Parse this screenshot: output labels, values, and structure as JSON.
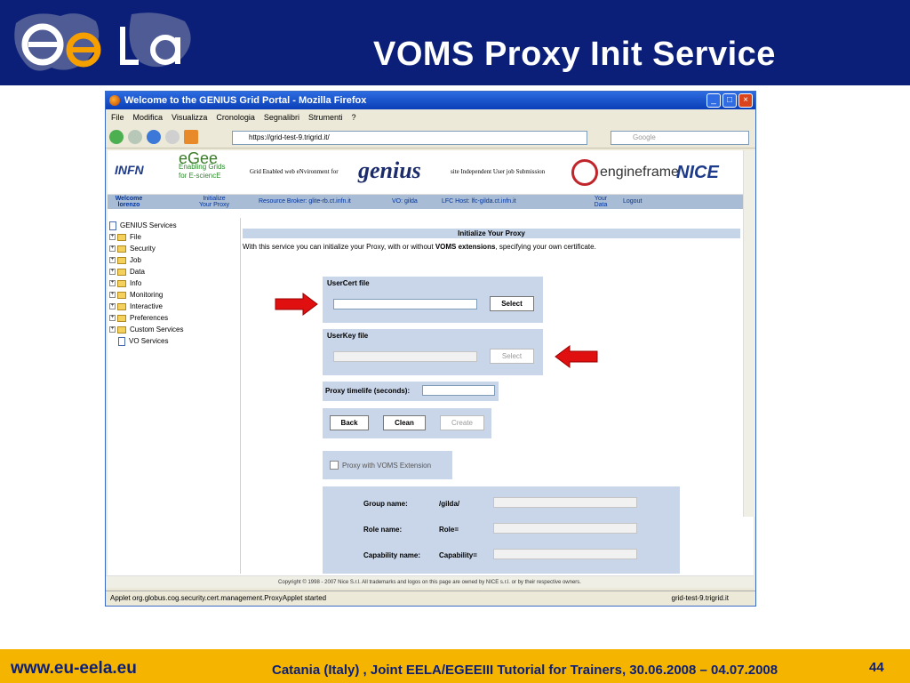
{
  "slide": {
    "title": "VOMS Proxy Init Service",
    "site": "www.eu-eela.eu",
    "footer": "Catania (Italy) , Joint EELA/EGEEIII Tutorial for Trainers, 30.06.2008 – 04.07.2008",
    "page_number": "44"
  },
  "browser": {
    "title": "Welcome to the GENIUS Grid Portal - Mozilla Firefox",
    "menu": [
      "File",
      "Modifica",
      "Visualizza",
      "Cronologia",
      "Segnalibri",
      "Strumenti",
      "?"
    ],
    "url": "https://grid-test-9.trigrid.it/",
    "search_placeholder": "Google",
    "status": "Applet org.globus.cog.security.cert.management.ProxyApplet started",
    "status_host": "grid-test-9.trigrid.it"
  },
  "portal": {
    "banner": {
      "infn": "INFN",
      "egee_logo": "eGee",
      "egee_tag1": "Enabling Grids",
      "egee_tag2": "for E-sciencE",
      "genius_left": "Grid Enabled web eNvironment for",
      "genius_logo": "genius",
      "genius_right": "site Independent User job Submission",
      "engine": "engineframe",
      "nice": "NICE"
    },
    "tabs": {
      "welcome": "Welcome",
      "user": "lorenzo",
      "init1": "Initialize",
      "init2": "Your Proxy",
      "rb": "Resource Broker: glite-rb.ct.infn.it",
      "vo": "VO: gilda",
      "lfc": "LFC Host: lfc-gilda.ct.infn.it",
      "data1": "Your",
      "data2": "Data",
      "logout": "Logout"
    },
    "tree": {
      "root": "GENIUS Services",
      "items": [
        "File",
        "Security",
        "Job",
        "Data",
        "Info",
        "Monitoring",
        "Interactive",
        "Preferences",
        "Custom Services",
        "VO Services"
      ]
    },
    "form": {
      "panel_title": "Initialize Your Proxy",
      "intro_pre": "With this service you can initialize your Proxy, with or without ",
      "intro_bold": "VOMS extensions",
      "intro_post": ", specifying your own certificate.",
      "usercert_label": "UserCert file",
      "userkey_label": "UserKey file",
      "select_label": "Select",
      "lifetime_label": "Proxy timelife (seconds):",
      "back_label": "Back",
      "clean_label": "Clean",
      "create_label": "Create",
      "voms_label": "Proxy with VOMS Extension",
      "group_label": "Group name:",
      "group_value": "/gilda/",
      "role_label": "Role name:",
      "role_value": "Role=",
      "cap_label": "Capability name:",
      "cap_value": "Capability="
    },
    "copyright": "Copyright © 1998 - 2007 Nice S.r.l. All trademarks and logos on this page are owned by NICE s.r.l. or by their respective owners."
  },
  "colors": {
    "topbar": "#0b1f78",
    "bottombar": "#f5b400",
    "arrow": "#e01010"
  }
}
